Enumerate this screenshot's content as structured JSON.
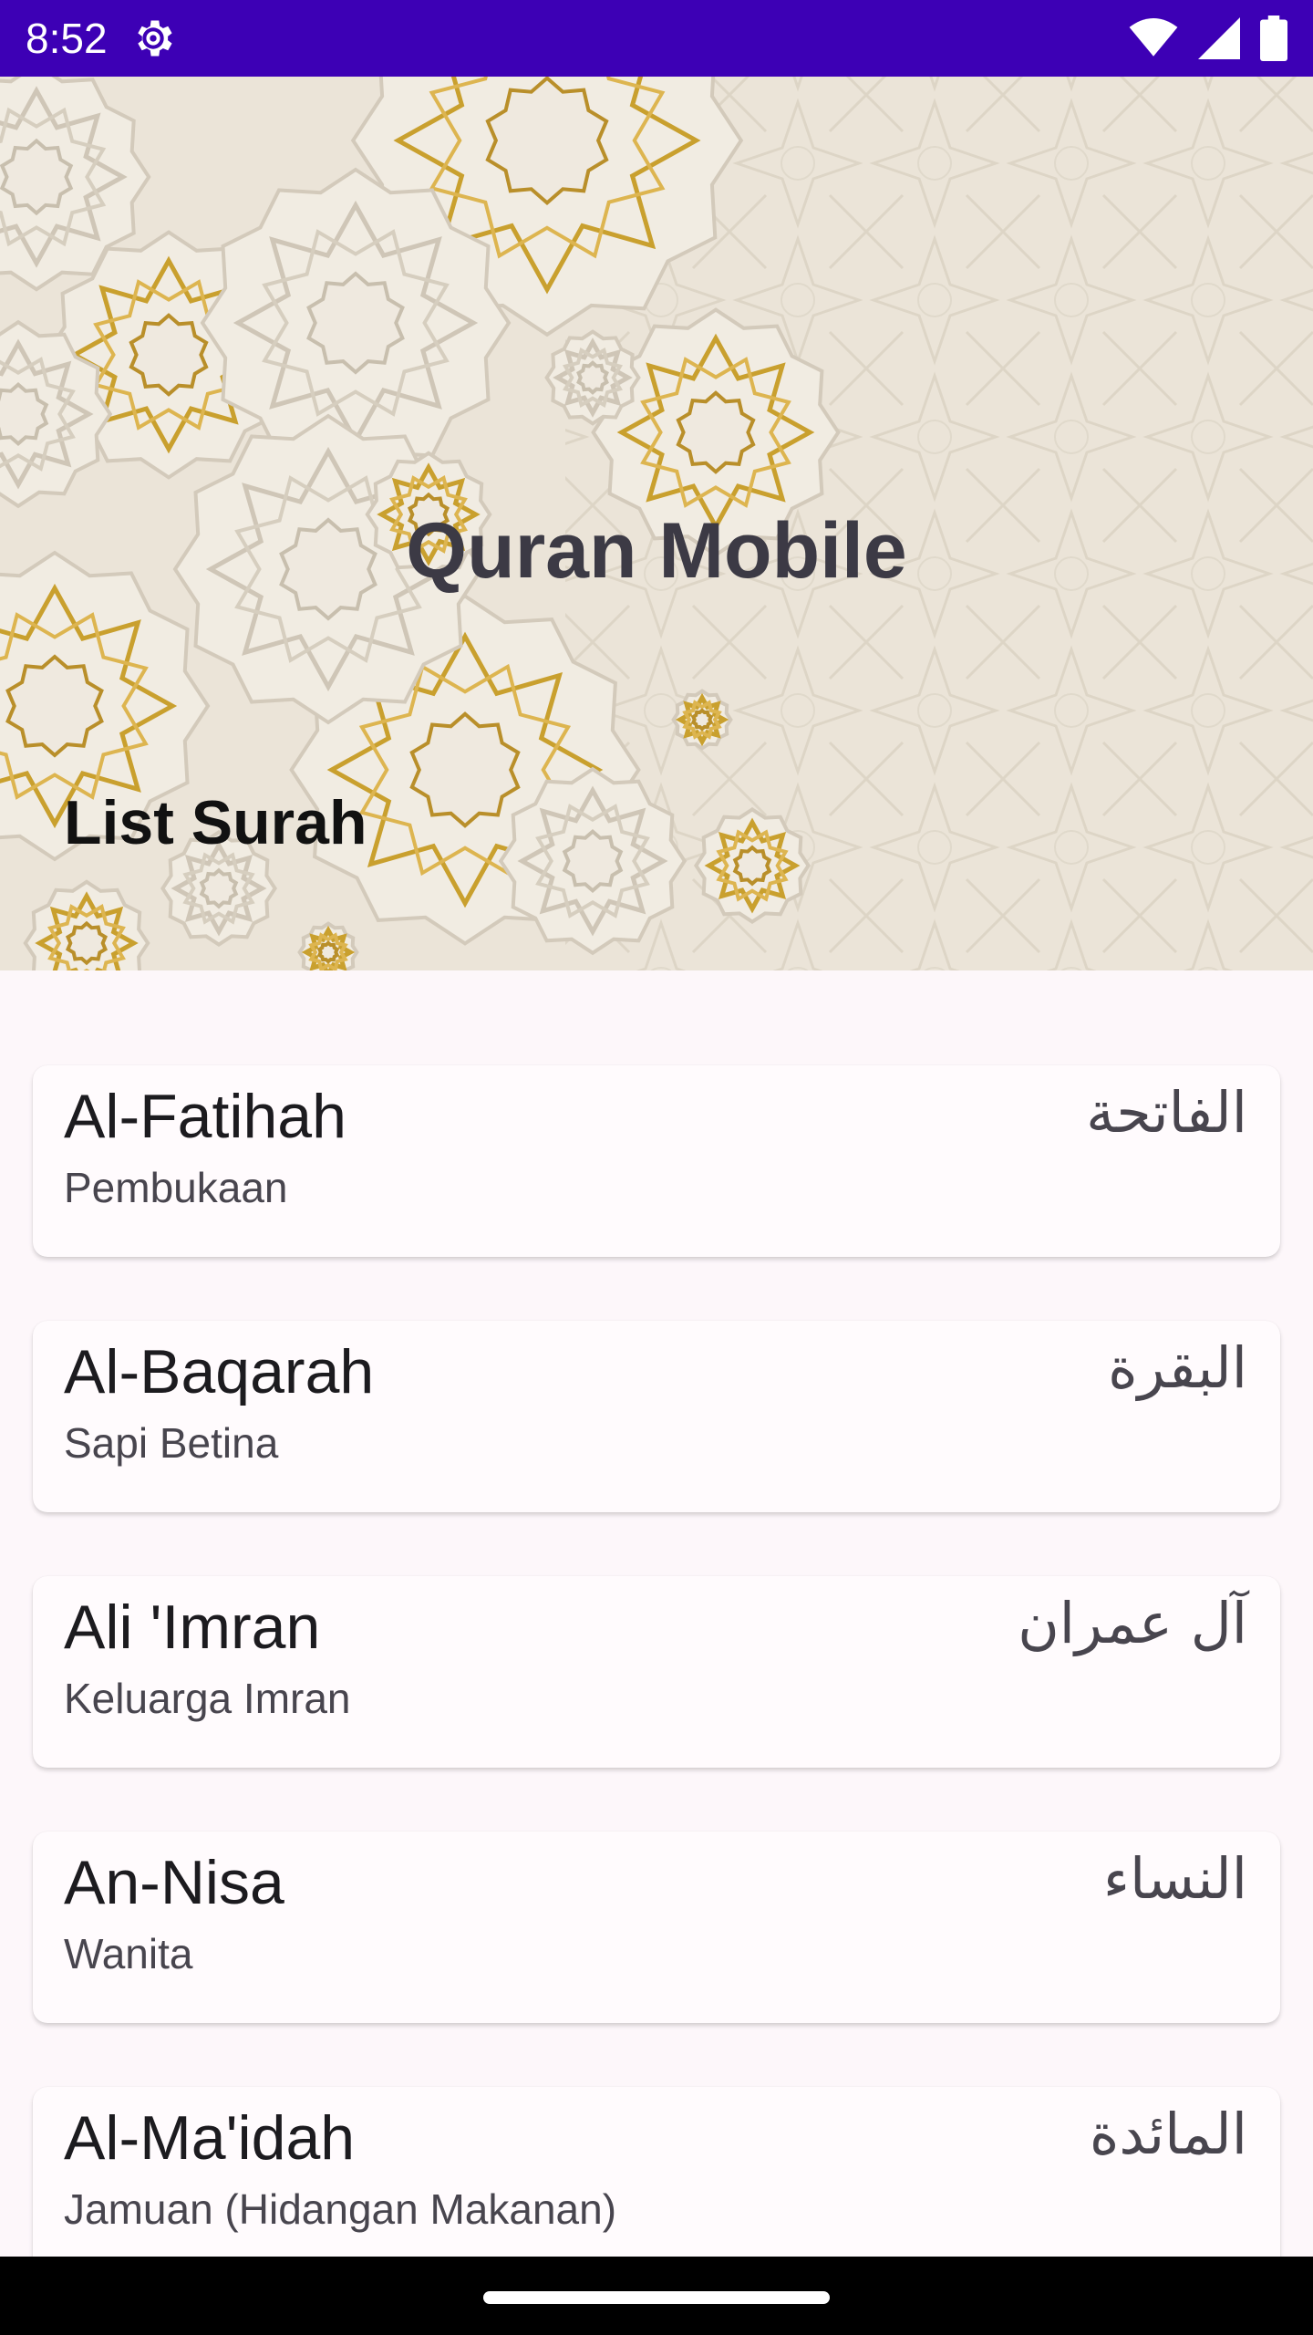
{
  "status_bar": {
    "time": "8:52",
    "icons": [
      "settings-gear-icon",
      "wifi-icon",
      "cellular-signal-icon",
      "battery-icon"
    ]
  },
  "header": {
    "title": "Quran Mobile",
    "subtitle": "List Surah"
  },
  "surahs": [
    {
      "latin": "Al-Fatihah",
      "translation": "Pembukaan",
      "arabic": "الفاتحة"
    },
    {
      "latin": "Al-Baqarah",
      "translation": "Sapi Betina",
      "arabic": "البقرة"
    },
    {
      "latin": "Ali 'Imran",
      "translation": "Keluarga Imran",
      "arabic": "آل عمران"
    },
    {
      "latin": "An-Nisa",
      "translation": "Wanita",
      "arabic": "النساء"
    },
    {
      "latin": "Al-Ma'idah",
      "translation": "Jamuan (Hidangan Makanan)",
      "arabic": "المائدة"
    }
  ],
  "colors": {
    "status_bar": "#3d00b5",
    "header_background": "#ebe4d8",
    "ornament_gold": "#c9a02e",
    "list_background": "#fdf7fa"
  }
}
